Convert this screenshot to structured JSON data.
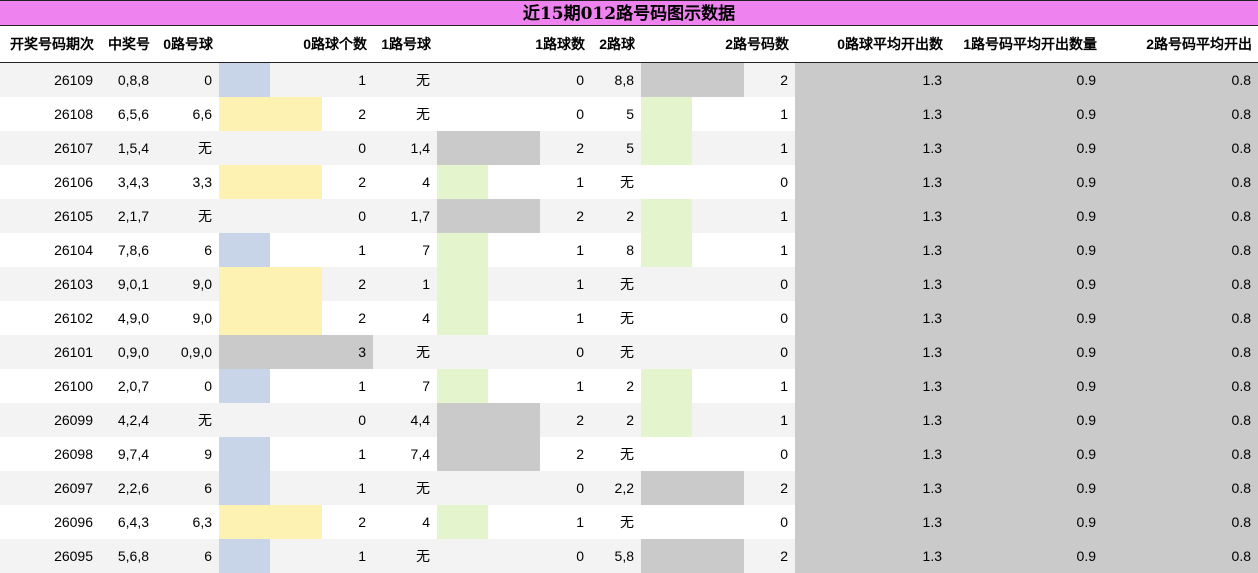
{
  "title": "近15期012路号码图示数据",
  "colors": {
    "title_bg": "#ee82ee",
    "blue": "#c8d4e8",
    "yellow": "#fdf2b2",
    "gray": "#cacaca",
    "green": "#e4f4cc"
  },
  "headers": [
    "开奖号码期次",
    "中奖号",
    "0路号球",
    "0路球个数",
    "1路号球",
    "1路球数",
    "2路球",
    "2路号码数",
    "0路球平均开出数",
    "1路号码平均开出数量",
    "2路号码平均开出"
  ],
  "rows": [
    {
      "issue": "26109",
      "numbers": "0,8,8",
      "r0_balls": "0",
      "r0_count": 1,
      "r1_balls": "无",
      "r1_count": 0,
      "r2_balls": "8,8",
      "r2_count": 2,
      "avg0": "1.3",
      "avg1": "0.9",
      "avg2": "0.8"
    },
    {
      "issue": "26108",
      "numbers": "6,5,6",
      "r0_balls": "6,6",
      "r0_count": 2,
      "r1_balls": "无",
      "r1_count": 0,
      "r2_balls": "5",
      "r2_count": 1,
      "avg0": "1.3",
      "avg1": "0.9",
      "avg2": "0.8"
    },
    {
      "issue": "26107",
      "numbers": "1,5,4",
      "r0_balls": "无",
      "r0_count": 0,
      "r1_balls": "1,4",
      "r1_count": 2,
      "r2_balls": "5",
      "r2_count": 1,
      "avg0": "1.3",
      "avg1": "0.9",
      "avg2": "0.8"
    },
    {
      "issue": "26106",
      "numbers": "3,4,3",
      "r0_balls": "3,3",
      "r0_count": 2,
      "r1_balls": "4",
      "r1_count": 1,
      "r2_balls": "无",
      "r2_count": 0,
      "avg0": "1.3",
      "avg1": "0.9",
      "avg2": "0.8"
    },
    {
      "issue": "26105",
      "numbers": "2,1,7",
      "r0_balls": "无",
      "r0_count": 0,
      "r1_balls": "1,7",
      "r1_count": 2,
      "r2_balls": "2",
      "r2_count": 1,
      "avg0": "1.3",
      "avg1": "0.9",
      "avg2": "0.8"
    },
    {
      "issue": "26104",
      "numbers": "7,8,6",
      "r0_balls": "6",
      "r0_count": 1,
      "r1_balls": "7",
      "r1_count": 1,
      "r2_balls": "8",
      "r2_count": 1,
      "avg0": "1.3",
      "avg1": "0.9",
      "avg2": "0.8"
    },
    {
      "issue": "26103",
      "numbers": "9,0,1",
      "r0_balls": "9,0",
      "r0_count": 2,
      "r1_balls": "1",
      "r1_count": 1,
      "r2_balls": "无",
      "r2_count": 0,
      "avg0": "1.3",
      "avg1": "0.9",
      "avg2": "0.8"
    },
    {
      "issue": "26102",
      "numbers": "4,9,0",
      "r0_balls": "9,0",
      "r0_count": 2,
      "r1_balls": "4",
      "r1_count": 1,
      "r2_balls": "无",
      "r2_count": 0,
      "avg0": "1.3",
      "avg1": "0.9",
      "avg2": "0.8"
    },
    {
      "issue": "26101",
      "numbers": "0,9,0",
      "r0_balls": "0,9,0",
      "r0_count": 3,
      "r1_balls": "无",
      "r1_count": 0,
      "r2_balls": "无",
      "r2_count": 0,
      "avg0": "1.3",
      "avg1": "0.9",
      "avg2": "0.8"
    },
    {
      "issue": "26100",
      "numbers": "2,0,7",
      "r0_balls": "0",
      "r0_count": 1,
      "r1_balls": "7",
      "r1_count": 1,
      "r2_balls": "2",
      "r2_count": 1,
      "avg0": "1.3",
      "avg1": "0.9",
      "avg2": "0.8"
    },
    {
      "issue": "26099",
      "numbers": "4,2,4",
      "r0_balls": "无",
      "r0_count": 0,
      "r1_balls": "4,4",
      "r1_count": 2,
      "r2_balls": "2",
      "r2_count": 1,
      "avg0": "1.3",
      "avg1": "0.9",
      "avg2": "0.8"
    },
    {
      "issue": "26098",
      "numbers": "9,7,4",
      "r0_balls": "9",
      "r0_count": 1,
      "r1_balls": "7,4",
      "r1_count": 2,
      "r2_balls": "无",
      "r2_count": 0,
      "avg0": "1.3",
      "avg1": "0.9",
      "avg2": "0.8"
    },
    {
      "issue": "26097",
      "numbers": "2,2,6",
      "r0_balls": "6",
      "r0_count": 1,
      "r1_balls": "无",
      "r1_count": 0,
      "r2_balls": "2,2",
      "r2_count": 2,
      "avg0": "1.3",
      "avg1": "0.9",
      "avg2": "0.8"
    },
    {
      "issue": "26096",
      "numbers": "6,4,3",
      "r0_balls": "6,3",
      "r0_count": 2,
      "r1_balls": "4",
      "r1_count": 1,
      "r2_balls": "无",
      "r2_count": 0,
      "avg0": "1.3",
      "avg1": "0.9",
      "avg2": "0.8"
    },
    {
      "issue": "26095",
      "numbers": "5,6,8",
      "r0_balls": "6",
      "r0_count": 1,
      "r1_balls": "无",
      "r1_count": 0,
      "r2_balls": "5,8",
      "r2_count": 2,
      "avg0": "1.3",
      "avg1": "0.9",
      "avg2": "0.8"
    }
  ]
}
